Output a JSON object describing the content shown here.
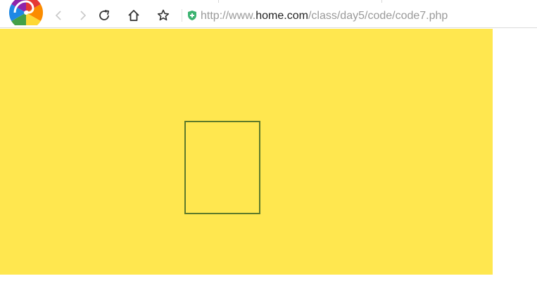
{
  "browser": {
    "address_bar": {
      "url_prefix": "http://www.",
      "url_host": "home.com",
      "url_path": "/class/day5/code/code7.php"
    },
    "nav_icons": [
      "back-icon",
      "forward-icon",
      "reload-icon",
      "home-icon",
      "bookmark-star-icon",
      "security-shield-icon"
    ]
  },
  "page": {
    "background_color": "#ffe74f",
    "box_border_color": "#5e7a2b"
  }
}
